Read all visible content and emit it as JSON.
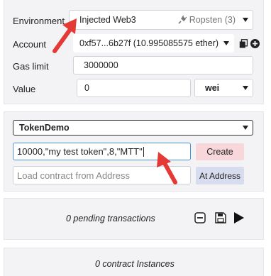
{
  "run": {
    "environment_label": "Environment",
    "environment_value": "Injected Web3",
    "network_value": "Ropsten (3)",
    "account_label": "Account",
    "account_value": "0xf57...6b27f (10.995085575 ether)",
    "gas_label": "Gas limit",
    "gas_value": "3000000",
    "value_label": "Value",
    "value_amount": "0",
    "value_unit": "wei"
  },
  "deploy": {
    "contract_select": "TokenDemo",
    "constructor_args": "10000,\"my test token\",8,\"MTT\"",
    "create_label": "Create",
    "load_placeholder": "Load contract from Address",
    "at_address_label": "At Address"
  },
  "transactions": {
    "pending_text": "0 pending transactions"
  },
  "instances": {
    "count_text": "0 contract Instances"
  },
  "colors": {
    "accent_red": "#e53935",
    "create_bg": "#f8d7da",
    "at_address_bg": "#d7dcef",
    "field_border_active": "#4a90d9"
  },
  "icons": [
    "plug-icon",
    "copy-icon",
    "add-icon",
    "clear-icon",
    "save-icon",
    "play-icon",
    "arrow-annotation"
  ]
}
